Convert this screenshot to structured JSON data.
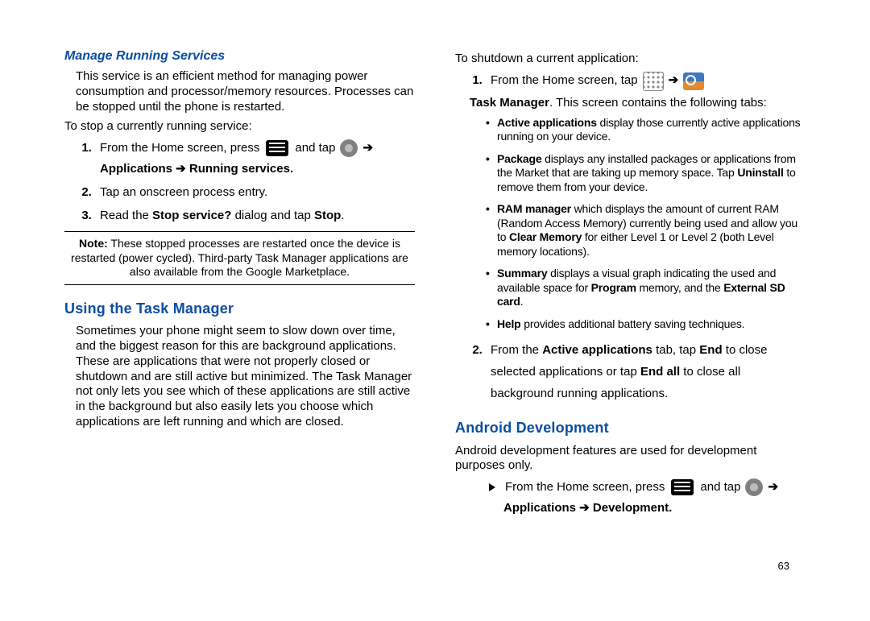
{
  "page_number": "63",
  "left": {
    "h1": "Manage Running Services",
    "p1": "This service is an efficient method for managing power consumption and processor/memory resources. Processes can be stopped until the phone is restarted.",
    "p2": "To stop a currently running service:",
    "step1_a": "From the Home screen, press ",
    "step1_b": " and tap ",
    "arrow": "➔",
    "step1_c": "Applications ➔ Running services.",
    "step2": "Tap an onscreen process entry.",
    "step3_a": "Read the ",
    "step3_b": "Stop service?",
    "step3_c": " dialog and tap ",
    "step3_d": "Stop",
    "step3_e": ".",
    "note_label": "Note:",
    "note_body": " These stopped processes are restarted once the device is restarted (power cycled). Third-party Task Manager applications are also available from the Google Marketplace.",
    "h2": "Using the Task Manager",
    "p3": "Sometimes your phone might seem to slow down over time, and the biggest reason for this are background applications. These are applications that were not properly closed or shutdown and are still active but minimized. The Task Manager not only lets you see which of these applications are still active in the background but also easily lets you choose which applications are left running and which are closed."
  },
  "right": {
    "p1": "To shutdown a current application:",
    "step1_a": "From the Home screen, tap ",
    "arrow": "➔",
    "tm_a": "Task Manager",
    "tm_b": ". This screen contains the following tabs:",
    "b1_a": "Active applications",
    "b1_b": " display those currently active applications running on your device.",
    "b2_a": "Package",
    "b2_b": " displays any installed packages or applications from the Market that are taking up memory space. Tap ",
    "b2_c": "Uninstall",
    "b2_d": " to remove them from your device.",
    "b3_a": "RAM manager",
    "b3_b": " which displays the amount of current RAM (Random Access Memory) currently being used and allow you to ",
    "b3_c": "Clear Memory",
    "b3_d": " for either Level 1 or Level 2 (both Level memory locations).",
    "b4_a": "Summary",
    "b4_b": " displays a visual graph indicating the used and available space for ",
    "b4_c": "Program",
    "b4_d": " memory, and the ",
    "b4_e": "External SD card",
    "b4_f": ".",
    "b5_a": "Help",
    "b5_b": " provides additional battery saving techniques.",
    "step2_a": "From the ",
    "step2_b": "Active applications",
    "step2_c": " tab, tap ",
    "step2_d": "End",
    "step2_e": " to close selected applications or tap ",
    "step2_f": "End all",
    "step2_g": " to close all background running applications.",
    "h_android": "Android Development",
    "p_android": "Android development features are used for development purposes only.",
    "ad_a": "From the Home screen, press ",
    "ad_b": " and tap ",
    "ad_c": "Applications ➔ Development."
  }
}
